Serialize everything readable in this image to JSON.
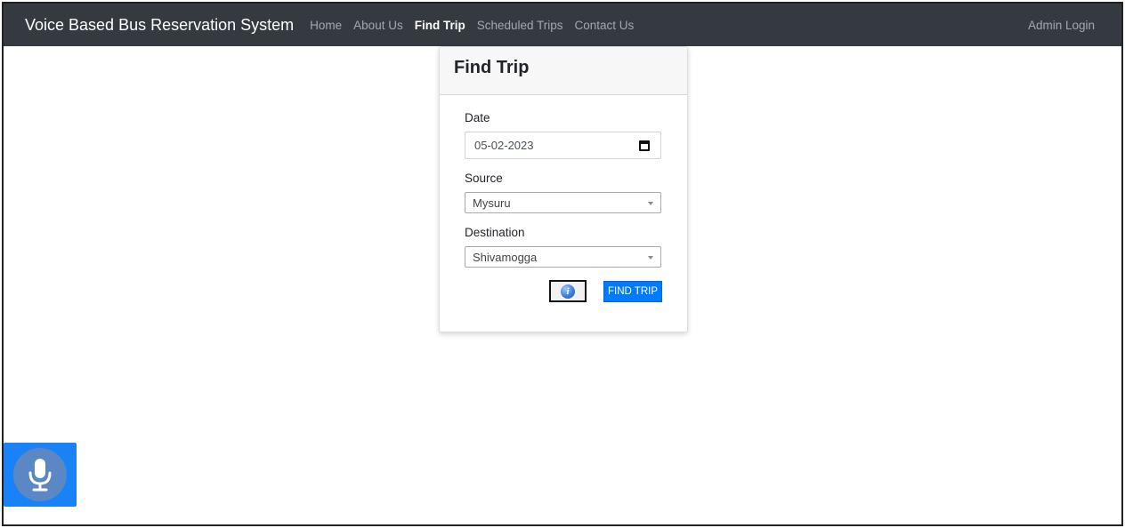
{
  "navbar": {
    "brand": "Voice Based Bus Reservation System",
    "links": [
      {
        "label": "Home",
        "active": false
      },
      {
        "label": "About Us",
        "active": false
      },
      {
        "label": "Find Trip",
        "active": true
      },
      {
        "label": "Scheduled Trips",
        "active": false
      },
      {
        "label": "Contact Us",
        "active": false
      }
    ],
    "admin_login": "Admin Login"
  },
  "card": {
    "title": "Find Trip",
    "date": {
      "label": "Date",
      "value": "05-02-2023",
      "icon": "calendar-icon"
    },
    "source": {
      "label": "Source",
      "value": "Mysuru"
    },
    "destination": {
      "label": "Destination",
      "value": "Shivamogga"
    },
    "info_icon": "info-icon",
    "find_button": "FIND TRIP"
  },
  "voice": {
    "icon": "microphone-icon"
  },
  "colors": {
    "navbar_bg": "#343a40",
    "primary": "#007bff",
    "mic_bg": "#1a82f7",
    "mic_circle": "#5b87c4"
  }
}
